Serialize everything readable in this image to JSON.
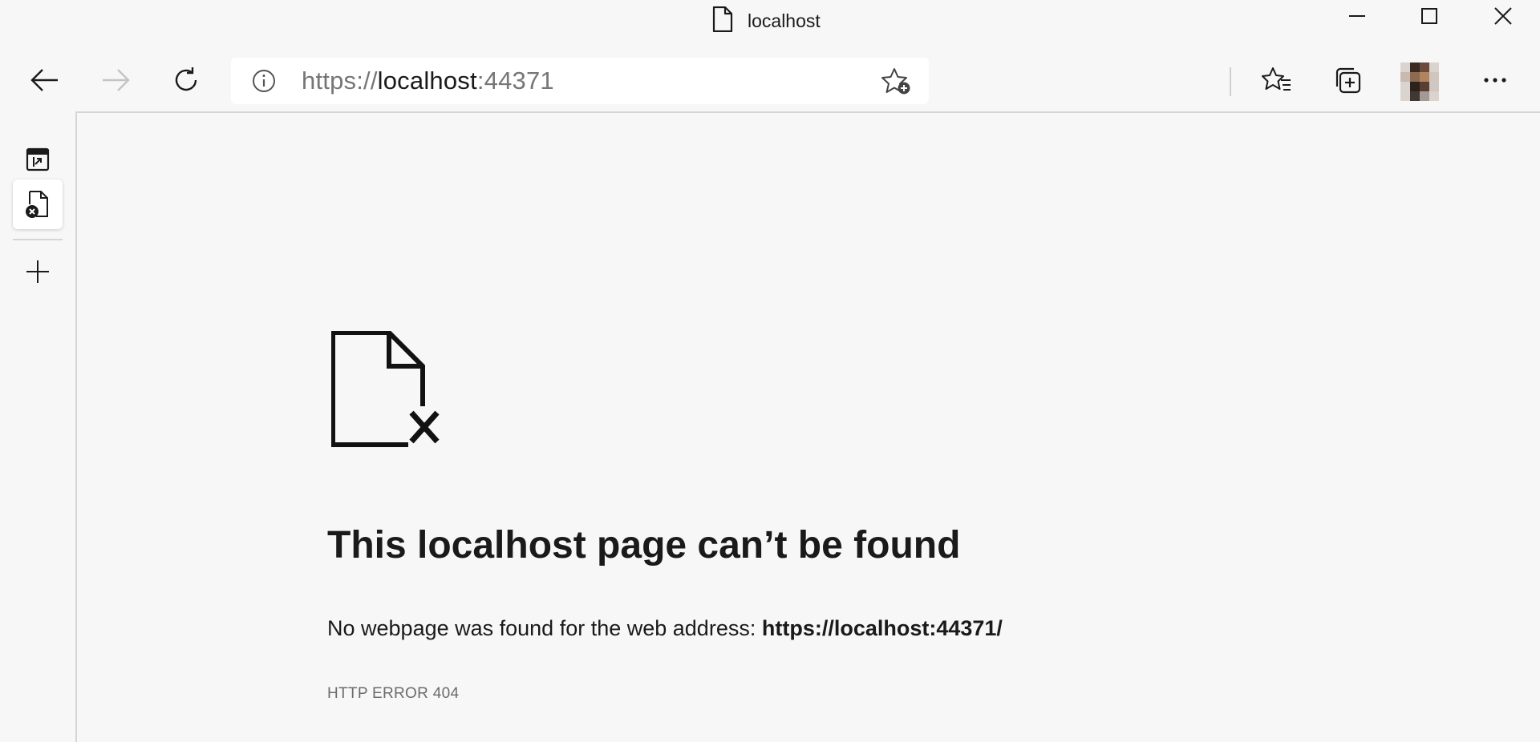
{
  "window": {
    "title": "localhost"
  },
  "toolbar": {
    "address": {
      "scheme": "https://",
      "host": "localhost",
      "port": ":44371"
    }
  },
  "icons": {
    "title": "page-icon",
    "back": "arrow-left-icon",
    "forward": "arrow-right-icon",
    "refresh": "refresh-icon",
    "site_info": "info-icon",
    "add_favorite": "star-add-icon",
    "favorites": "favorites-icon",
    "collections": "collections-icon",
    "more": "more-icon",
    "minimize": "minimize-icon",
    "maximize": "maximize-icon",
    "close": "close-icon",
    "tab_actions": "tab-actions-icon",
    "error_tab": "error-page-icon",
    "new_tab": "plus-icon",
    "error_page": "file-error-icon"
  },
  "error_page": {
    "title": "This localhost page can’t be found",
    "message_prefix": "No webpage was found for the web address:",
    "message_url": "https://localhost:44371/",
    "error_code": "HTTP ERROR 404"
  },
  "colors": {
    "background": "#f7f7f7",
    "address_bg": "#ffffff",
    "text": "#1a1a1a",
    "muted": "#767676",
    "disabled_icon": "#c4c4c4"
  }
}
